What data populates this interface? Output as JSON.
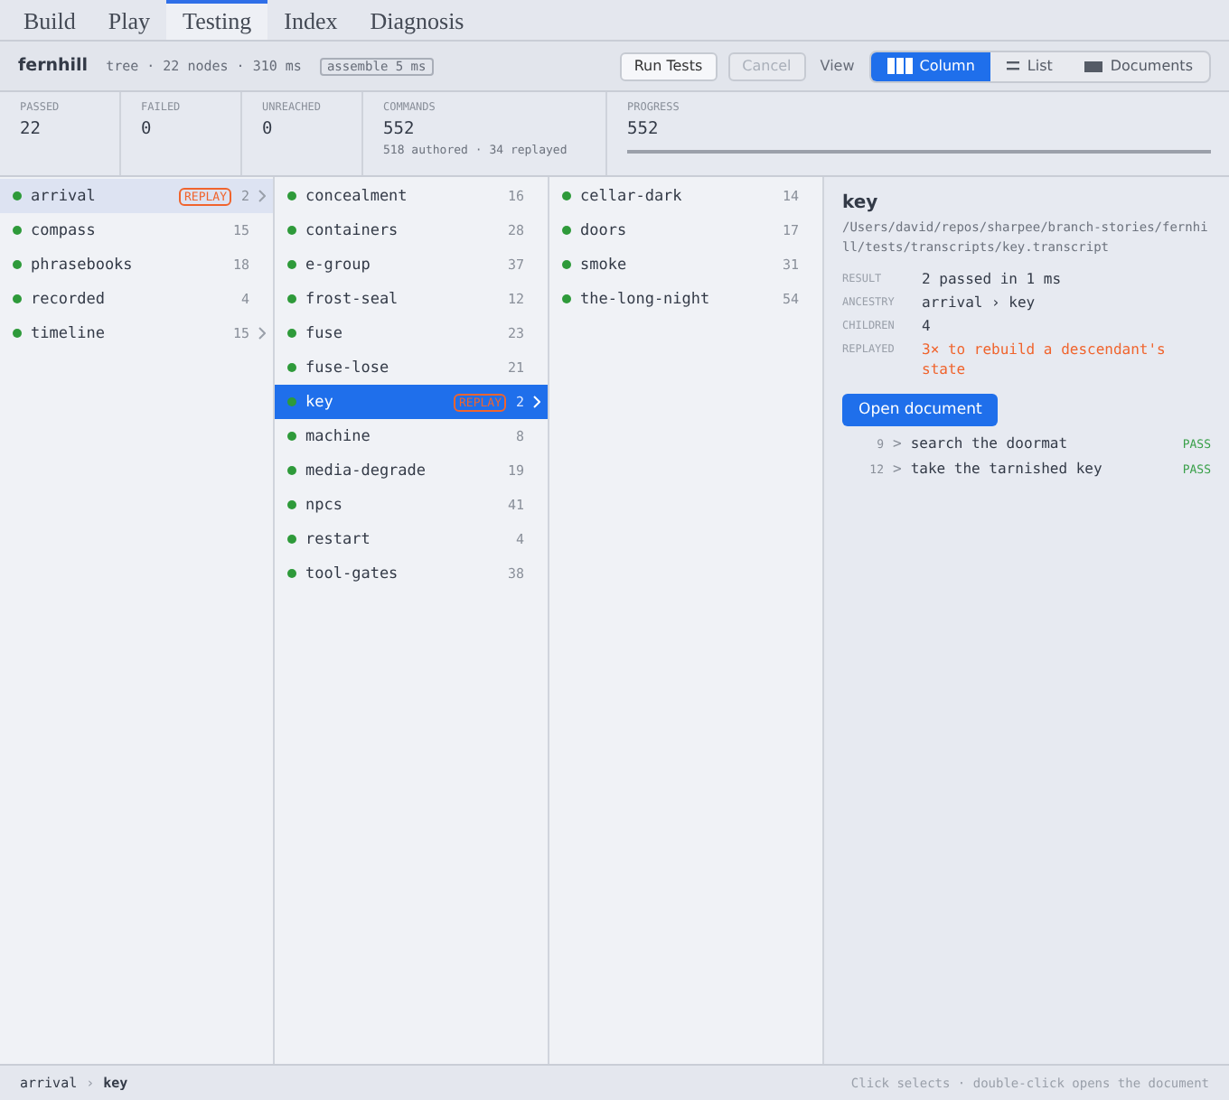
{
  "tabs": [
    {
      "label": "Build",
      "selected": false
    },
    {
      "label": "Play",
      "selected": false
    },
    {
      "label": "Testing",
      "selected": true
    },
    {
      "label": "Index",
      "selected": false
    },
    {
      "label": "Diagnosis",
      "selected": false
    }
  ],
  "toolbar": {
    "project": "fernhill",
    "meta": "tree · 22 nodes · 310 ms",
    "badge": "assemble 5 ms",
    "run": "Run Tests",
    "cancel": {
      "label": "Cancel",
      "disabled": true
    },
    "view_label": "View",
    "views": [
      {
        "label": "Column",
        "kind": "column",
        "selected": true
      },
      {
        "label": "List",
        "kind": "list",
        "selected": false
      },
      {
        "label": "Documents",
        "kind": "documents",
        "selected": false
      }
    ]
  },
  "stats": [
    {
      "label": "PASSED",
      "value": "22"
    },
    {
      "label": "FAILED",
      "value": "0"
    },
    {
      "label": "UNREACHED",
      "value": "0"
    },
    {
      "label": "COMMANDS",
      "value": "552",
      "sub": "518 authored · 34 replayed"
    }
  ],
  "progress": {
    "label": "PROGRESS",
    "value": "552",
    "level": 1
  },
  "columns": [
    [
      {
        "name": "arrival",
        "count": "2",
        "replay": "REPLAY",
        "expandable": true,
        "selected": true
      },
      {
        "name": "compass",
        "count": "15",
        "expandable": false,
        "selected": false
      },
      {
        "name": "phrasebooks",
        "count": "18",
        "expandable": false,
        "selected": false
      },
      {
        "name": "recorded",
        "count": "4",
        "expandable": false,
        "selected": false
      },
      {
        "name": "timeline",
        "count": "15",
        "expandable": true,
        "selected": false
      }
    ],
    [
      {
        "name": "concealment",
        "count": "16",
        "expandable": false,
        "selected": false
      },
      {
        "name": "containers",
        "count": "28",
        "expandable": false,
        "selected": false
      },
      {
        "name": "e-group",
        "count": "37",
        "expandable": false,
        "selected": false
      },
      {
        "name": "frost-seal",
        "count": "12",
        "expandable": false,
        "selected": false
      },
      {
        "name": "fuse",
        "count": "23",
        "expandable": false,
        "selected": false
      },
      {
        "name": "fuse-lose",
        "count": "21",
        "expandable": false,
        "selected": false
      },
      {
        "name": "key",
        "count": "2",
        "replay": "REPLAY",
        "expandable": true,
        "selected": true
      },
      {
        "name": "machine",
        "count": "8",
        "expandable": false,
        "selected": false
      },
      {
        "name": "media-degrade",
        "count": "19",
        "expandable": false,
        "selected": false
      },
      {
        "name": "npcs",
        "count": "41",
        "expandable": false,
        "selected": false
      },
      {
        "name": "restart",
        "count": "4",
        "expandable": false,
        "selected": false
      },
      {
        "name": "tool-gates",
        "count": "38",
        "expandable": false,
        "selected": false
      }
    ],
    [
      {
        "name": "cellar-dark",
        "count": "14",
        "expandable": false,
        "selected": false
      },
      {
        "name": "doors",
        "count": "17",
        "expandable": false,
        "selected": false
      },
      {
        "name": "smoke",
        "count": "31",
        "expandable": false,
        "selected": false
      },
      {
        "name": "the-long-night",
        "count": "54",
        "expandable": false,
        "selected": false
      }
    ]
  ],
  "detail": {
    "title": "key",
    "path": "/Users/david/repos/sharpee/branch-stories/fernhill/tests/transcripts/key.transcript",
    "fields": [
      {
        "label": "RESULT",
        "value": "2 passed in 1 ms",
        "kind": "plain"
      },
      {
        "label": "ANCESTRY",
        "value": "arrival › key",
        "kind": "plain"
      },
      {
        "label": "CHILDREN",
        "value": "4",
        "kind": "plain"
      },
      {
        "label": "REPLAYED",
        "value": "3× to rebuild a descendant's state",
        "kind": "warning"
      }
    ],
    "open": "Open document",
    "commands": [
      {
        "line": "9",
        "prompt": ">",
        "text": "search the doormat",
        "status": "PASS"
      },
      {
        "line": "12",
        "prompt": ">",
        "text": "take the tarnished key",
        "status": "PASS"
      }
    ]
  },
  "status": {
    "crumbs": [
      "arrival",
      "key"
    ],
    "separator": "›",
    "hint": "Click selects · double-click opens the document"
  }
}
